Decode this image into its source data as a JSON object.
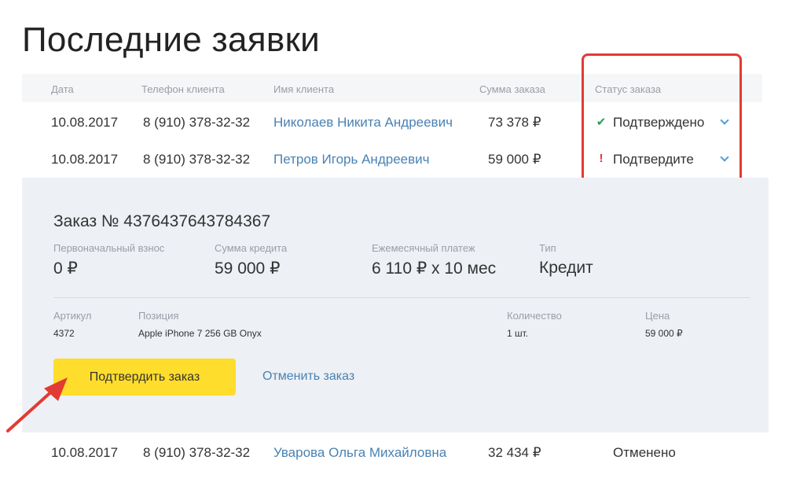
{
  "page_title": "Последние заявки",
  "table": {
    "headers": {
      "date": "Дата",
      "phone": "Телефон клиента",
      "name": "Имя клиента",
      "sum": "Сумма заказа",
      "status": "Статус заказа"
    },
    "rows": [
      {
        "date": "10.08.2017",
        "phone": "8 (910) 378-32-32",
        "name": "Николаев Никита Андреевич",
        "sum": "73 378 ₽",
        "status": "Подтверждено",
        "status_icon": "check-icon"
      },
      {
        "date": "10.08.2017",
        "phone": "8 (910) 378-32-32",
        "name": "Петров Игорь Андреевич",
        "sum": "59 000 ₽",
        "status": "Подтвердите",
        "status_icon": "exclamation-icon"
      },
      {
        "date": "10.08.2017",
        "phone": "8 (910) 378-32-32",
        "name": "Уварова Ольга Михайловна",
        "sum": "32 434 ₽",
        "status": "Отменено"
      }
    ]
  },
  "details": {
    "order_title": "Заказ № 4376437643784367",
    "meta": [
      {
        "label": "Первоначальный взнос",
        "value": "0 ₽"
      },
      {
        "label": "Сумма кредита",
        "value": "59 000 ₽"
      },
      {
        "label": "Ежемесячный платеж",
        "value": "6 110 ₽ x 10 мес"
      },
      {
        "label": "Тип",
        "value": "Кредит"
      }
    ],
    "positions": {
      "headers": {
        "article": "Артикул",
        "position": "Позиция",
        "quantity": "Количество",
        "price": "Цена"
      },
      "items": [
        {
          "article": "4372",
          "position": "Apple iPhone 7 256 GB Onyx",
          "quantity": "1 шт.",
          "price": "59 000 ₽"
        }
      ]
    },
    "confirm_label": "Подтвердить заказ",
    "cancel_label": "Отменить заказ"
  },
  "colors": {
    "accent_yellow": "#ffdd2d",
    "link_blue": "#4a82b4",
    "status_ok": "#2e9b58",
    "status_warn": "#e5303a",
    "annotation_red": "#e23b32"
  }
}
